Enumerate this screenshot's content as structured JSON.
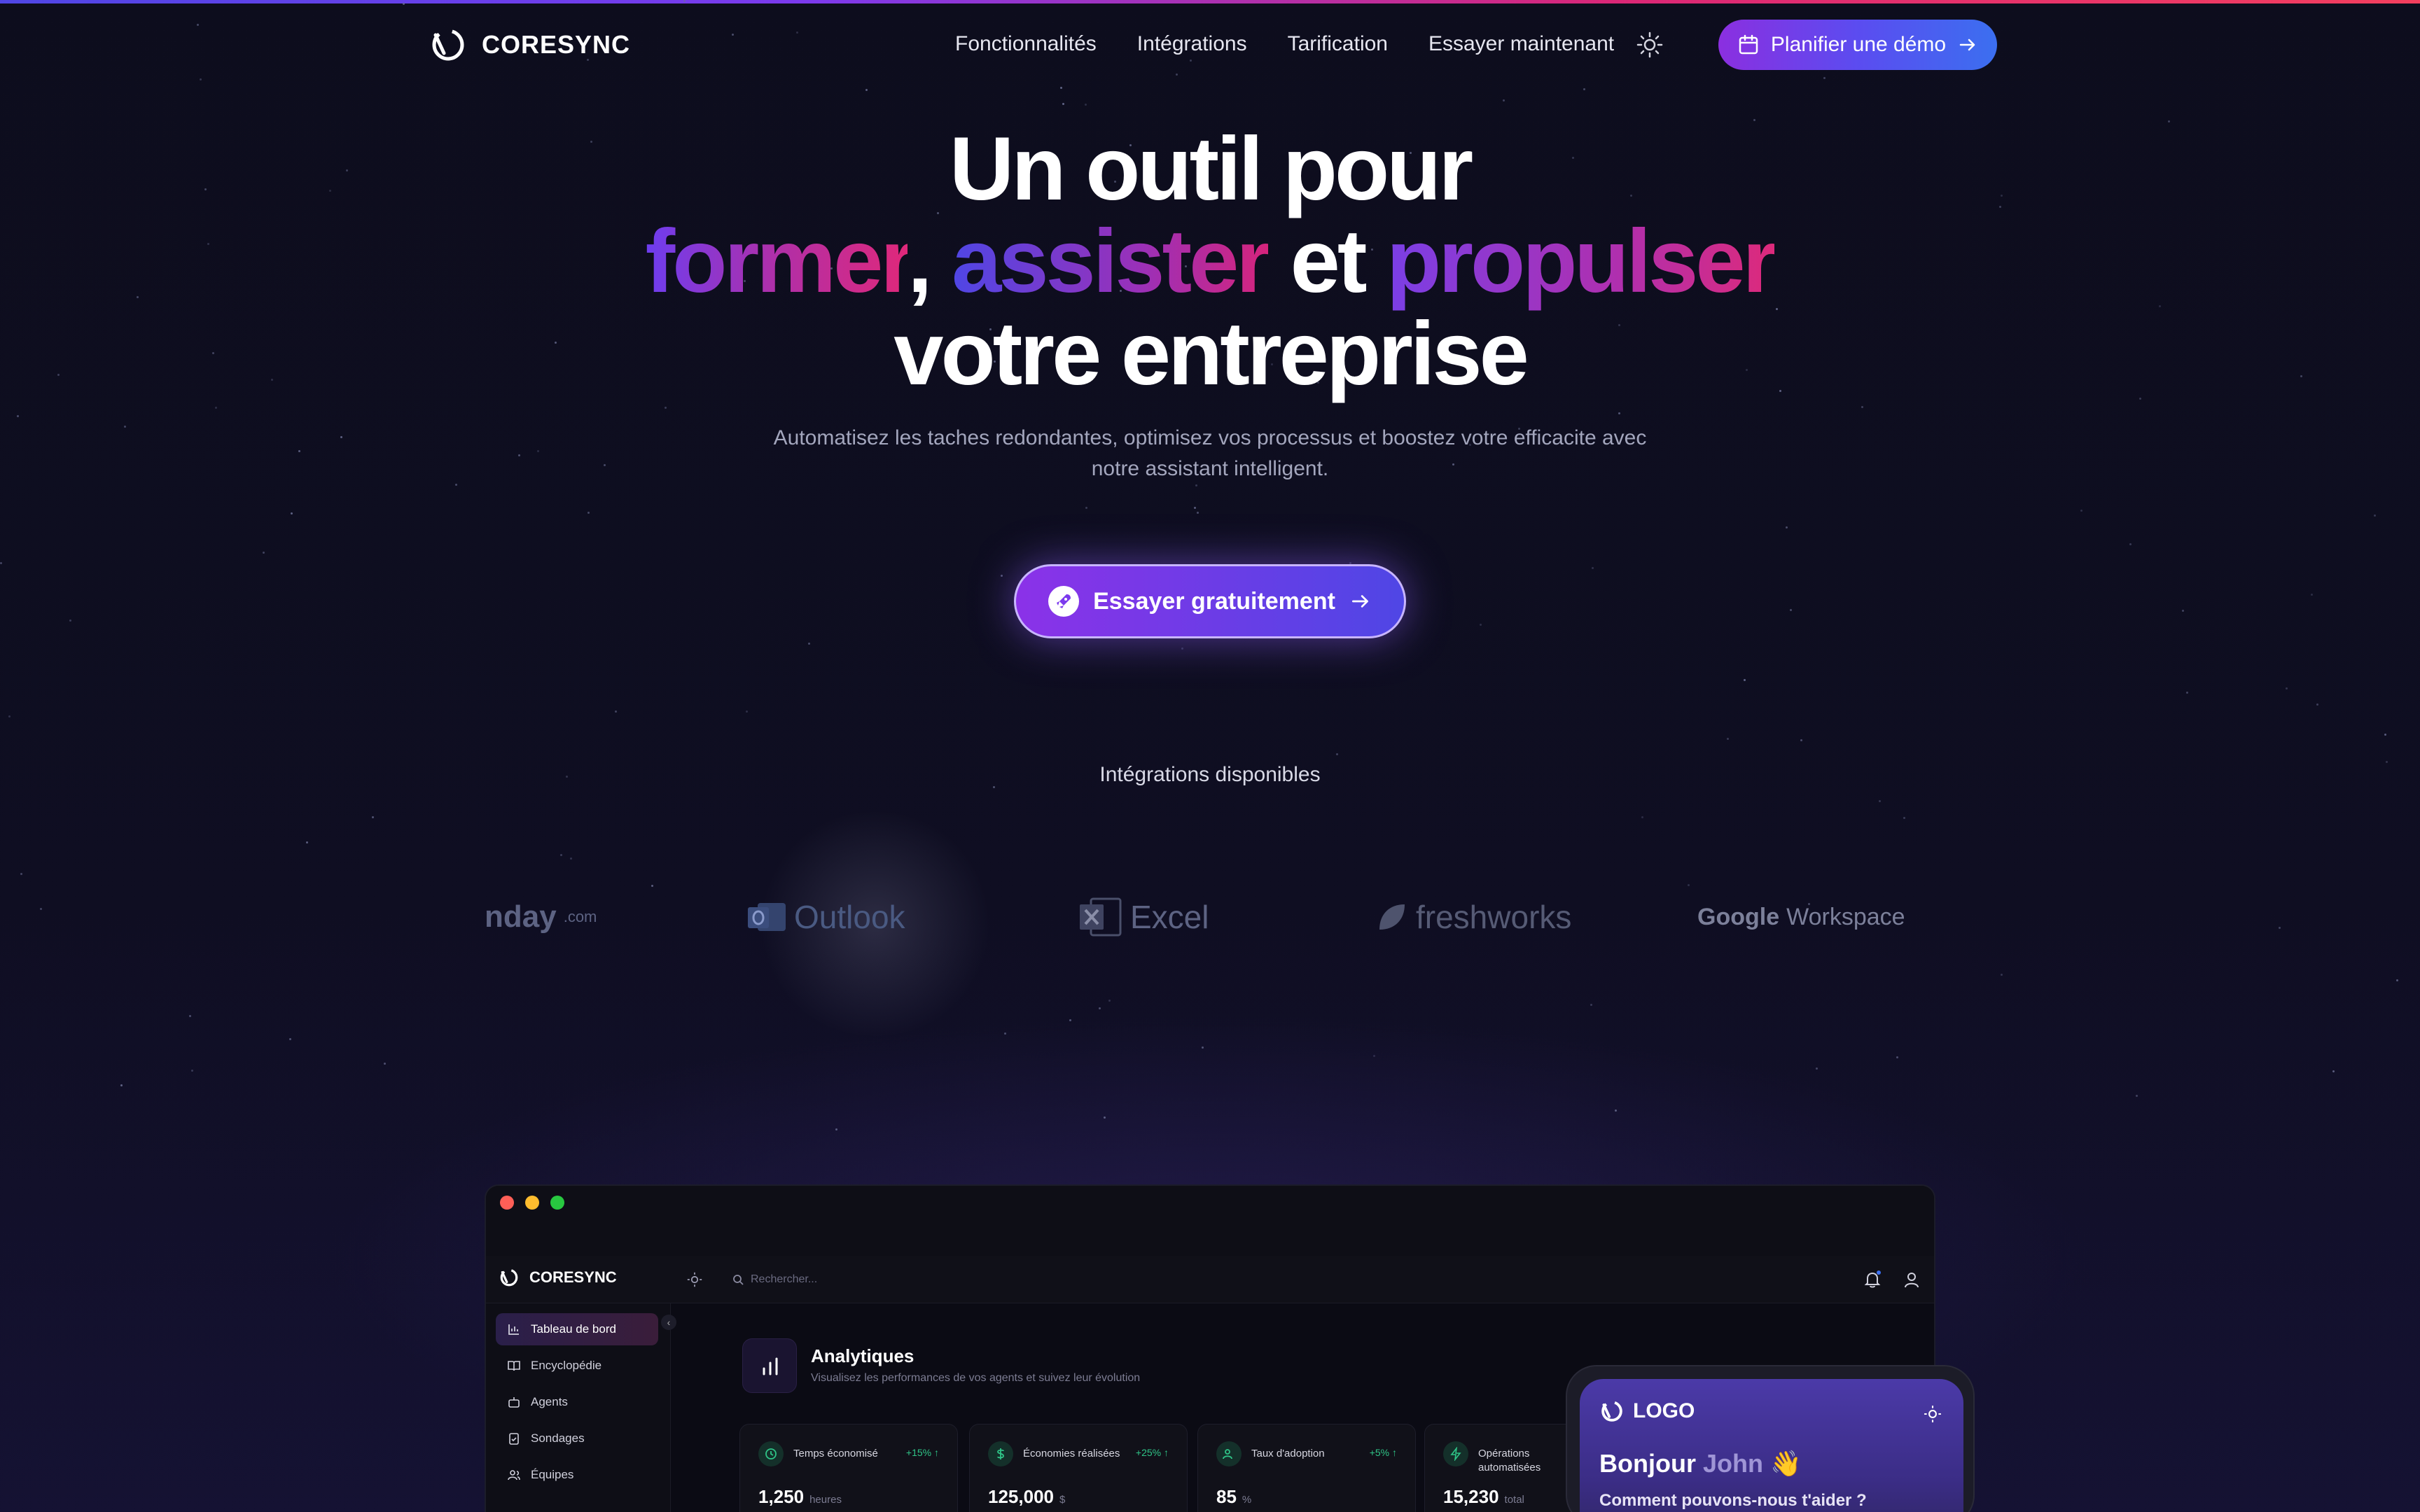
{
  "nav": {
    "brand": "CORESYNC",
    "links": [
      "Fonctionnalités",
      "Intégrations",
      "Tarification",
      "Essayer maintenant"
    ],
    "demo_button": "Planifier une démo"
  },
  "hero": {
    "line1": "Un outil pour",
    "word1": "former",
    "comma": ",",
    "word2": "assister",
    "connector": "et",
    "word3": "propulser",
    "line3": "votre entreprise",
    "subtitle": "Automatisez les taches redondantes, optimisez vos processus et boostez votre efficacite avec notre assistant intelligent.",
    "cta": "Essayer gratuitement"
  },
  "integrations": {
    "title": "Intégrations disponibles",
    "logos": {
      "monday": "nday",
      "monday_suffix": ".com",
      "outlook": "Outlook",
      "excel": "Excel",
      "freshworks": "freshworks",
      "google": "Google",
      "workspace": "Workspace"
    }
  },
  "app": {
    "brand": "CORESYNC",
    "search_placeholder": "Rechercher...",
    "sidebar": [
      "Tableau de bord",
      "Encyclopédie",
      "Agents",
      "Sondages",
      "Équipes"
    ],
    "title": "Analytiques",
    "subtitle": "Visualisez les performances de vos agents et suivez leur évolution",
    "cards": [
      {
        "label": "Temps économisé",
        "delta": "+15% ↑",
        "value": "1,250",
        "unit": "heures"
      },
      {
        "label": "Économies réalisées",
        "delta": "+25% ↑",
        "value": "125,000",
        "unit": "$"
      },
      {
        "label": "Taux d'adoption",
        "delta": "+5% ↑",
        "value": "85",
        "unit": "%"
      },
      {
        "label": "Opérations automatisées",
        "delta": "",
        "value": "15,230",
        "unit": "total"
      }
    ]
  },
  "chat": {
    "logo": "LOGO",
    "greeting": "Bonjour",
    "name": "John",
    "wave": "👋",
    "help": "Comment pouvons-nous t'aider ?"
  },
  "colors": {
    "background": "#0d0d1d",
    "accent_purple": "#7c3aed",
    "accent_pink": "#db2777",
    "accent_blue": "#3b6ff0",
    "positive": "#2fc487"
  }
}
